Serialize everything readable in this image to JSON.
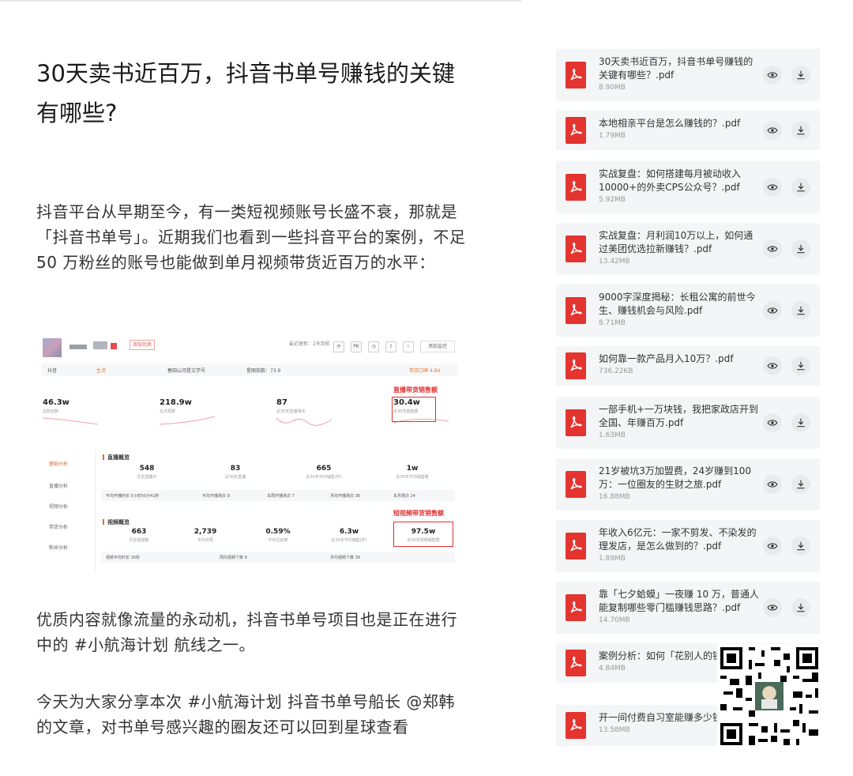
{
  "article": {
    "title": "30天卖书近百万，抖音书单号赚钱的关键有哪些?",
    "p1": "抖音平台从早期至今，有一类短视频账号长盛不衰，那就是「抖音书单号」。近期我们也看到一些抖音平台的案例，不足 50 万粉丝的账号也能做到单月视频带货近百万的水平：",
    "p2": "优质内容就像流量的永动机，抖音书单号项目也是正在进行中的 #小航海计划 航线之一。",
    "p3": "今天为大家分享本次 #小航海计划 抖音书单号船长 @郑韩 的文章，对书单号感兴趣的圈友还可以回到星球查看"
  },
  "screenshot": {
    "tag": "添加优质",
    "update_time": "最近更新：2天到前",
    "icon_labels": [
      "PK"
    ],
    "add_monitor": "添加监控",
    "info_left": "抖音",
    "info_mid": "生活",
    "info_text": "春田山河是文学号",
    "info_score": "星图指数：73.9",
    "info_right": "带货口碑 4.84",
    "stats": [
      {
        "value": "46.3w",
        "label": "总粉丝数"
      },
      {
        "value": "218.9w",
        "label": "总点赞数"
      },
      {
        "value": "87",
        "label": "近30天直播场次"
      },
      {
        "value": "30.4w",
        "label": "近30天销售额"
      }
    ],
    "live_label": "直播带货销售额",
    "video_label": "短视频带货销售额",
    "nav": [
      "基础分析",
      "直播分析",
      "视频分析",
      "带货分析",
      "粉丝分析"
    ],
    "live_section": "直播概览",
    "live_stats": [
      {
        "value": "548",
        "label": "历史直播次"
      },
      {
        "value": "83",
        "label": "近30天直播"
      },
      {
        "value": "665",
        "label": "近30天平均销售(件)"
      },
      {
        "value": "1w",
        "label": "近30天平均销售额"
      }
    ],
    "live_row": [
      "平均开播时长 5小时50分41秒",
      "平均开播场次 9",
      "本周开播场次 7",
      "月均开播场次 36",
      "本月场次 24"
    ],
    "video_section": "视频概览",
    "video_stats": [
      {
        "value": "663",
        "label": "历史视频数"
      },
      {
        "value": "2,739",
        "label": "平均点赞"
      },
      {
        "value": "0.59%",
        "label": "平均互动率"
      },
      {
        "value": "6.3w",
        "label": "近30天平均销售(件)"
      },
      {
        "value": "97.5w",
        "label": "近30天视频销售额"
      }
    ],
    "video_row": [
      "视频平均时长 16秒",
      "周均视频个数 9",
      "月均视频个数 39"
    ]
  },
  "files": [
    {
      "name": "30天卖书近百万，抖音书单号赚钱的关键有哪些？.pdf",
      "size": "8.90MB"
    },
    {
      "name": "本地相亲平台是怎么赚钱的？.pdf",
      "size": "1.79MB"
    },
    {
      "name": "实战复盘：如何搭建每月被动收入10000+的外卖CPS公众号？.pdf",
      "size": "5.92MB"
    },
    {
      "name": "实战复盘：月利润10万以上，如何通过美团优选拉新赚钱？.pdf",
      "size": "13.42MB"
    },
    {
      "name": "9000字深度揭秘：长租公寓的前世今生、赚钱机会与风险.pdf",
      "size": "8.71MB"
    },
    {
      "name": "如何靠一款产品月入10万？.pdf",
      "size": "736.22KB"
    },
    {
      "name": "一部手机+一万块钱，我把家政店开到全国、年赚百万.pdf",
      "size": "1.63MB"
    },
    {
      "name": "21岁被坑3万加盟费，24岁赚到100万：一位圈友的生财之旅.pdf",
      "size": "16.88MB"
    },
    {
      "name": "年收入6亿元：一家不剪发、不染发的理发店，是怎么做到的？.pdf",
      "size": "1.89MB"
    },
    {
      "name": "靠「七夕蛤蟆」一夜赚 10 万，普通人能复制哪些零门槛赚钱思路？.pdf",
      "size": "14.70MB"
    },
    {
      "name": "案例分析：如何「花别人的钱」.pdf",
      "size": "4.84MB"
    },
    {
      "name": "开一间付费自习室能赚多少钱",
      "size": "13.58MB"
    }
  ],
  "colors": {
    "pdf": "#e3342f",
    "highlight": "#e03030",
    "item_bg": "#f4f5f6"
  }
}
